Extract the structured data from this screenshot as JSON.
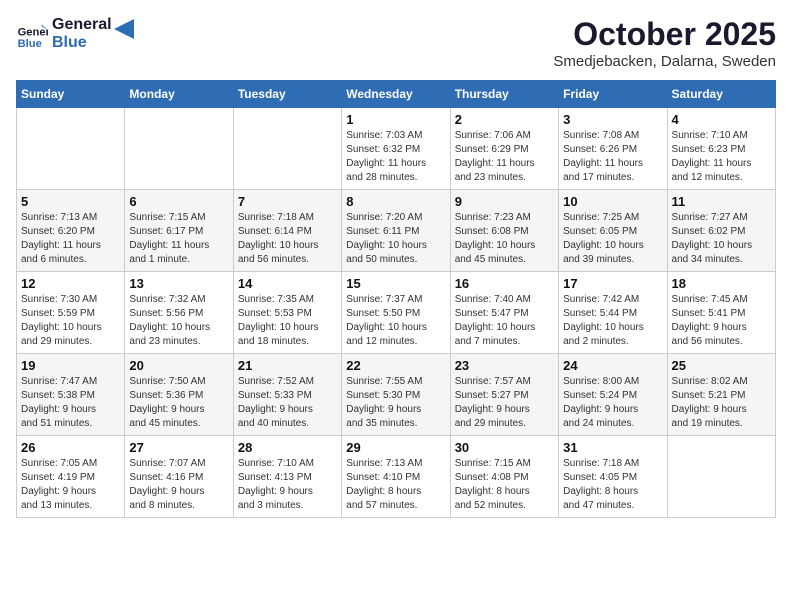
{
  "header": {
    "logo_line1": "General",
    "logo_line2": "Blue",
    "month": "October 2025",
    "location": "Smedjebacken, Dalarna, Sweden"
  },
  "days_of_week": [
    "Sunday",
    "Monday",
    "Tuesday",
    "Wednesday",
    "Thursday",
    "Friday",
    "Saturday"
  ],
  "weeks": [
    [
      {
        "day": "",
        "info": ""
      },
      {
        "day": "",
        "info": ""
      },
      {
        "day": "",
        "info": ""
      },
      {
        "day": "1",
        "info": "Sunrise: 7:03 AM\nSunset: 6:32 PM\nDaylight: 11 hours\nand 28 minutes."
      },
      {
        "day": "2",
        "info": "Sunrise: 7:06 AM\nSunset: 6:29 PM\nDaylight: 11 hours\nand 23 minutes."
      },
      {
        "day": "3",
        "info": "Sunrise: 7:08 AM\nSunset: 6:26 PM\nDaylight: 11 hours\nand 17 minutes."
      },
      {
        "day": "4",
        "info": "Sunrise: 7:10 AM\nSunset: 6:23 PM\nDaylight: 11 hours\nand 12 minutes."
      }
    ],
    [
      {
        "day": "5",
        "info": "Sunrise: 7:13 AM\nSunset: 6:20 PM\nDaylight: 11 hours\nand 6 minutes."
      },
      {
        "day": "6",
        "info": "Sunrise: 7:15 AM\nSunset: 6:17 PM\nDaylight: 11 hours\nand 1 minute."
      },
      {
        "day": "7",
        "info": "Sunrise: 7:18 AM\nSunset: 6:14 PM\nDaylight: 10 hours\nand 56 minutes."
      },
      {
        "day": "8",
        "info": "Sunrise: 7:20 AM\nSunset: 6:11 PM\nDaylight: 10 hours\nand 50 minutes."
      },
      {
        "day": "9",
        "info": "Sunrise: 7:23 AM\nSunset: 6:08 PM\nDaylight: 10 hours\nand 45 minutes."
      },
      {
        "day": "10",
        "info": "Sunrise: 7:25 AM\nSunset: 6:05 PM\nDaylight: 10 hours\nand 39 minutes."
      },
      {
        "day": "11",
        "info": "Sunrise: 7:27 AM\nSunset: 6:02 PM\nDaylight: 10 hours\nand 34 minutes."
      }
    ],
    [
      {
        "day": "12",
        "info": "Sunrise: 7:30 AM\nSunset: 5:59 PM\nDaylight: 10 hours\nand 29 minutes."
      },
      {
        "day": "13",
        "info": "Sunrise: 7:32 AM\nSunset: 5:56 PM\nDaylight: 10 hours\nand 23 minutes."
      },
      {
        "day": "14",
        "info": "Sunrise: 7:35 AM\nSunset: 5:53 PM\nDaylight: 10 hours\nand 18 minutes."
      },
      {
        "day": "15",
        "info": "Sunrise: 7:37 AM\nSunset: 5:50 PM\nDaylight: 10 hours\nand 12 minutes."
      },
      {
        "day": "16",
        "info": "Sunrise: 7:40 AM\nSunset: 5:47 PM\nDaylight: 10 hours\nand 7 minutes."
      },
      {
        "day": "17",
        "info": "Sunrise: 7:42 AM\nSunset: 5:44 PM\nDaylight: 10 hours\nand 2 minutes."
      },
      {
        "day": "18",
        "info": "Sunrise: 7:45 AM\nSunset: 5:41 PM\nDaylight: 9 hours\nand 56 minutes."
      }
    ],
    [
      {
        "day": "19",
        "info": "Sunrise: 7:47 AM\nSunset: 5:38 PM\nDaylight: 9 hours\nand 51 minutes."
      },
      {
        "day": "20",
        "info": "Sunrise: 7:50 AM\nSunset: 5:36 PM\nDaylight: 9 hours\nand 45 minutes."
      },
      {
        "day": "21",
        "info": "Sunrise: 7:52 AM\nSunset: 5:33 PM\nDaylight: 9 hours\nand 40 minutes."
      },
      {
        "day": "22",
        "info": "Sunrise: 7:55 AM\nSunset: 5:30 PM\nDaylight: 9 hours\nand 35 minutes."
      },
      {
        "day": "23",
        "info": "Sunrise: 7:57 AM\nSunset: 5:27 PM\nDaylight: 9 hours\nand 29 minutes."
      },
      {
        "day": "24",
        "info": "Sunrise: 8:00 AM\nSunset: 5:24 PM\nDaylight: 9 hours\nand 24 minutes."
      },
      {
        "day": "25",
        "info": "Sunrise: 8:02 AM\nSunset: 5:21 PM\nDaylight: 9 hours\nand 19 minutes."
      }
    ],
    [
      {
        "day": "26",
        "info": "Sunrise: 7:05 AM\nSunset: 4:19 PM\nDaylight: 9 hours\nand 13 minutes."
      },
      {
        "day": "27",
        "info": "Sunrise: 7:07 AM\nSunset: 4:16 PM\nDaylight: 9 hours\nand 8 minutes."
      },
      {
        "day": "28",
        "info": "Sunrise: 7:10 AM\nSunset: 4:13 PM\nDaylight: 9 hours\nand 3 minutes."
      },
      {
        "day": "29",
        "info": "Sunrise: 7:13 AM\nSunset: 4:10 PM\nDaylight: 8 hours\nand 57 minutes."
      },
      {
        "day": "30",
        "info": "Sunrise: 7:15 AM\nSunset: 4:08 PM\nDaylight: 8 hours\nand 52 minutes."
      },
      {
        "day": "31",
        "info": "Sunrise: 7:18 AM\nSunset: 4:05 PM\nDaylight: 8 hours\nand 47 minutes."
      },
      {
        "day": "",
        "info": ""
      }
    ]
  ]
}
